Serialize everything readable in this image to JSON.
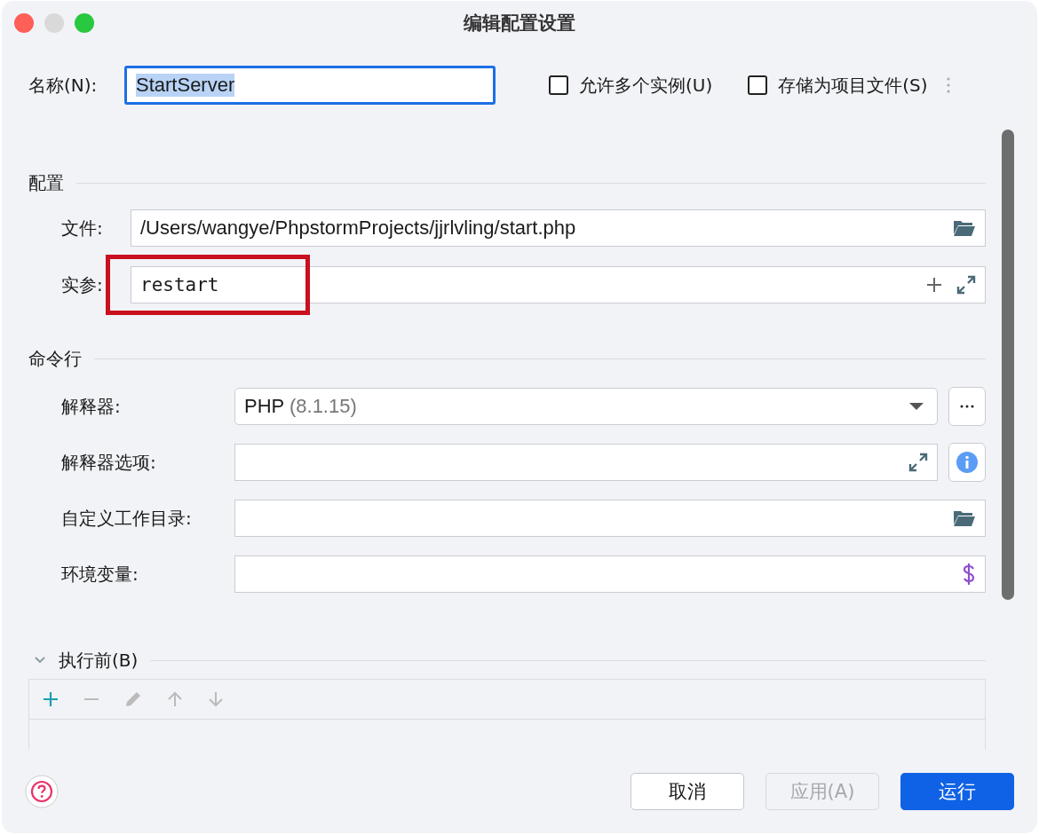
{
  "window": {
    "title": "编辑配置设置"
  },
  "name": {
    "label": "名称(N):",
    "value": "StartServer",
    "selected": true
  },
  "options": [
    {
      "label": "允许多个实例(U)",
      "checked": false
    },
    {
      "label": "存储为项目文件(S)",
      "checked": false
    }
  ],
  "config_section": {
    "title": "配置",
    "fields": [
      {
        "label": "文件:",
        "value": "/Users/wangye/PhpstormProjects/jjrlvling/start.php",
        "kind": "folder"
      },
      {
        "label": "实参:",
        "value": "restart",
        "kind": "args"
      }
    ]
  },
  "command_section": {
    "title": "命令行",
    "fields": [
      {
        "label": "解释器:",
        "kind": "select",
        "value": "PHP",
        "detail": "(8.1.15)"
      },
      {
        "label": "解释器选项:",
        "kind": "expand"
      },
      {
        "label": "自定义工作目录:",
        "kind": "folder"
      },
      {
        "label": "环境变量:",
        "kind": "env"
      }
    ]
  },
  "before_launch": {
    "title": "执行前(B)",
    "expanded": true
  },
  "buttons": [
    {
      "label": "取消",
      "kind": "secondary",
      "disabled": false
    },
    {
      "label": "应用(A)",
      "kind": "secondary",
      "disabled": true
    },
    {
      "label": "运行",
      "kind": "primary",
      "disabled": false
    }
  ]
}
